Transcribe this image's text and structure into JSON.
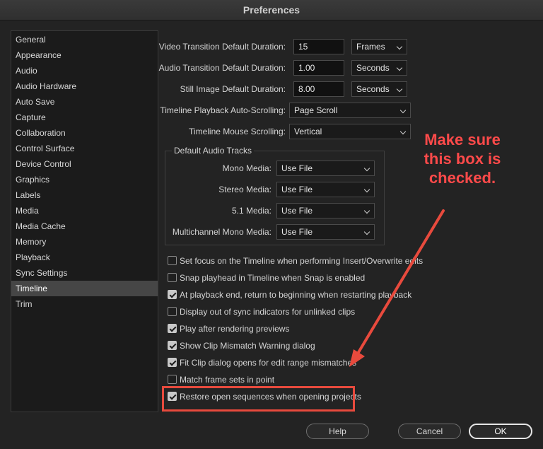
{
  "window": {
    "title": "Preferences"
  },
  "sidebar": {
    "items": [
      "General",
      "Appearance",
      "Audio",
      "Audio Hardware",
      "Auto Save",
      "Capture",
      "Collaboration",
      "Control Surface",
      "Device Control",
      "Graphics",
      "Labels",
      "Media",
      "Media Cache",
      "Memory",
      "Playback",
      "Sync Settings",
      "Timeline",
      "Trim"
    ],
    "selected": "Timeline"
  },
  "fields": {
    "video_transition": {
      "label": "Video Transition Default Duration:",
      "value": "15",
      "unit": "Frames"
    },
    "audio_transition": {
      "label": "Audio Transition Default Duration:",
      "value": "1.00",
      "unit": "Seconds"
    },
    "still_image": {
      "label": "Still Image Default Duration:",
      "value": "8.00",
      "unit": "Seconds"
    },
    "auto_scrolling": {
      "label": "Timeline Playback Auto-Scrolling:",
      "value": "Page Scroll"
    },
    "mouse_scrolling": {
      "label": "Timeline Mouse Scrolling:",
      "value": "Vertical"
    }
  },
  "audio_tracks": {
    "title": "Default Audio Tracks",
    "mono": {
      "label": "Mono Media:",
      "value": "Use File"
    },
    "stereo": {
      "label": "Stereo Media:",
      "value": "Use File"
    },
    "five_one": {
      "label": "5.1 Media:",
      "value": "Use File"
    },
    "multichannel": {
      "label": "Multichannel Mono Media:",
      "value": "Use File"
    }
  },
  "checkboxes": [
    {
      "label": "Set focus on the Timeline when performing Insert/Overwrite edits",
      "checked": false
    },
    {
      "label": "Snap playhead in Timeline when Snap is enabled",
      "checked": false
    },
    {
      "label": "At playback end, return to beginning when restarting playback",
      "checked": true
    },
    {
      "label": "Display out of sync indicators for unlinked clips",
      "checked": false
    },
    {
      "label": "Play after rendering previews",
      "checked": true
    },
    {
      "label": "Show Clip Mismatch Warning dialog",
      "checked": true
    },
    {
      "label": "Fit Clip dialog opens for edit range mismatches",
      "checked": true
    },
    {
      "label": "Match frame sets in point",
      "checked": false
    },
    {
      "label": "Restore open sequences when opening projects",
      "checked": true
    }
  ],
  "annotation": {
    "text_lines": [
      "Make sure",
      "this box is",
      "checked."
    ],
    "color": "#e84a3d"
  },
  "buttons": {
    "help": "Help",
    "cancel": "Cancel",
    "ok": "OK"
  }
}
